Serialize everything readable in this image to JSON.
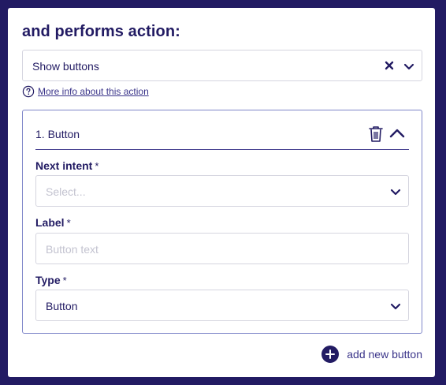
{
  "section": {
    "heading": "and performs action:"
  },
  "action": {
    "selected": "Show buttons",
    "info_link": "More info about this action"
  },
  "button_card": {
    "title": "1. Button",
    "fields": {
      "next_intent": {
        "label": "Next intent",
        "required_mark": "*",
        "placeholder": "Select..."
      },
      "label": {
        "label": "Label",
        "required_mark": "*",
        "placeholder": "Button text"
      },
      "type": {
        "label": "Type",
        "required_mark": "*",
        "value": "Button"
      }
    }
  },
  "footer": {
    "add_label": "add new button"
  },
  "icons": {
    "clear": "close-icon",
    "dropdown": "chevron-down-icon",
    "help": "question-circle-icon",
    "delete": "trash-icon",
    "collapse": "chevron-up-icon",
    "add": "plus-circle-icon"
  },
  "colors": {
    "page_background": "#221b63",
    "primary_text": "#221b63",
    "link": "#3b358a",
    "card_border": "#7f86c9",
    "placeholder": "#c3c3d0"
  }
}
